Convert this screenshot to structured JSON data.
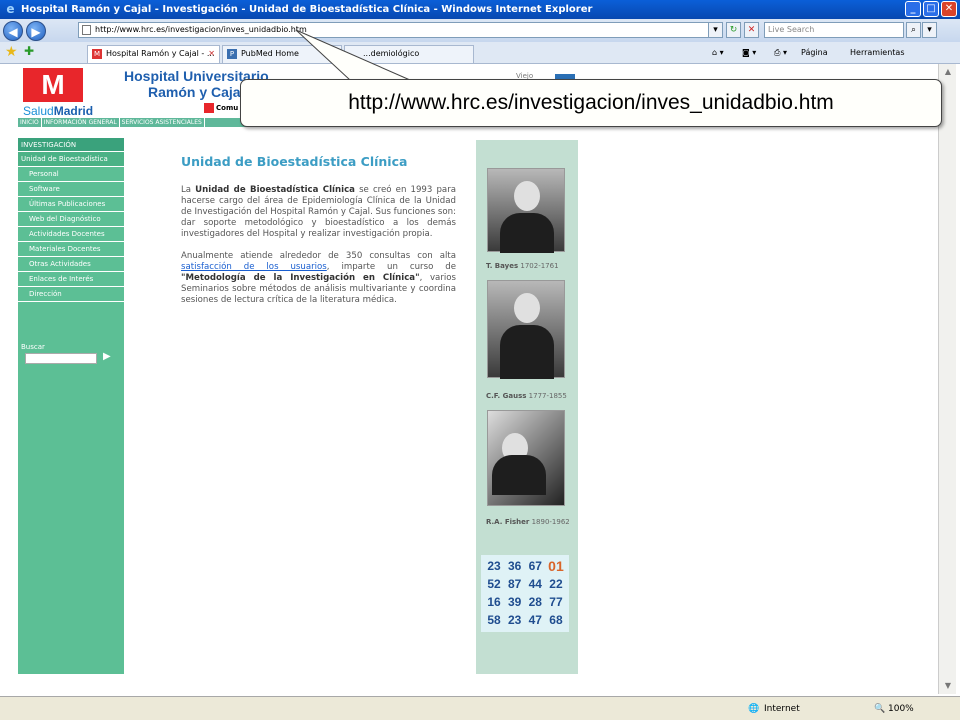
{
  "window": {
    "title": "Hospital Ramón y Cajal - Investigación - Unidad de Bioestadística Clínica - Windows Internet Explorer",
    "btn_min": "_",
    "btn_max": "□",
    "btn_close": "✕"
  },
  "addressbar": {
    "back": "◀",
    "forward": "▶",
    "url": "http://www.hrc.es/investigacion/inves_unidadbio.htm",
    "search_placeholder": "Live Search"
  },
  "tabs": [
    {
      "label": "Hospital Ramón y Cajal - ..."
    },
    {
      "label": "PubMed Home"
    },
    {
      "label": "...demiológico"
    }
  ],
  "commandbar": {
    "pagina": "Página",
    "herramientas": "Herramientas"
  },
  "site": {
    "logo_letter": "M",
    "salud": "Salud",
    "madrid": "Madrid",
    "hospital_line1": "Hospital Universitario",
    "hospital_line2": "Ramón y Caja",
    "comunidad": "Comu",
    "behind_text": "Viejo",
    "topnav": [
      "INICIO",
      "INFORMACIÓN GENERAL",
      "SERVICIOS ASISTENCIALES"
    ]
  },
  "sidebar": {
    "header": "INVESTIGACIÓN",
    "items": [
      {
        "label": "Unidad de Bioestadística"
      },
      {
        "label": "Personal"
      },
      {
        "label": "Software"
      },
      {
        "label": "Últimas Publicaciones"
      },
      {
        "label": "Web del Diagnóstico"
      },
      {
        "label": "Actividades Docentes"
      },
      {
        "label": "Materiales Docentes"
      },
      {
        "label": "Otras Actividades"
      },
      {
        "label": "Enlaces de Interés"
      },
      {
        "label": "Dirección"
      }
    ],
    "search_label": "Buscar"
  },
  "main": {
    "heading": "Unidad de Bioestadística Clínica",
    "p1_a": "La ",
    "p1_b": "Unidad de Bioestadística Clínica",
    "p1_c": " se creó en 1993 para hacerse cargo del área de Epidemiología Clínica de la Unidad de Investigación del Hospital Ramón y Cajal. Sus funciones son: dar soporte metodológico y bioestadístico a los demás investigadores del Hospital y realizar investigación propia.",
    "p2_a": "Anualmente atiende alrededor de 350 consultas con alta ",
    "p2_link": "satisfacción de los usuarios",
    "p2_b": ", imparte un curso de ",
    "p2_bold": "\"Metodología de la Investigación en Clínica\"",
    "p2_c": ", varios Seminarios sobre métodos de análisis multivariante y coordina sesiones de lectura crítica de la literatura médica."
  },
  "rightcol": {
    "captions": [
      {
        "name": "T. Bayes",
        "years": "1702-1761"
      },
      {
        "name": "C.F. Gauss",
        "years": "1777-1855"
      },
      {
        "name": "R.A. Fisher",
        "years": "1890-1962"
      }
    ],
    "numbers": [
      [
        "23",
        "36",
        "67",
        "01"
      ],
      [
        "52",
        "87",
        "44",
        "22"
      ],
      [
        "16",
        "39",
        "28",
        "77"
      ],
      [
        "58",
        "23",
        "47",
        "68"
      ]
    ]
  },
  "status": {
    "zone": "Internet",
    "zoom": "100%"
  },
  "callout": {
    "text": "http://www.hrc.es/investigacion/inves_unidadbio.htm"
  },
  "colors": {
    "sidebar_green": "#5cbf95",
    "right_col": "#c3dfd2",
    "heading_blue": "#3c9dc4",
    "titlebar_blue": "#0a5fd8"
  }
}
